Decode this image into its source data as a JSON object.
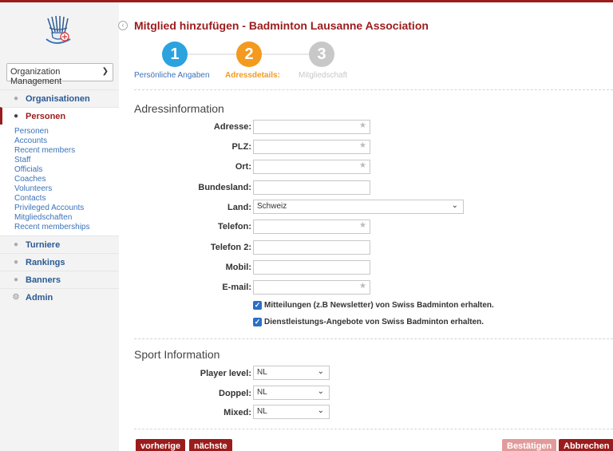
{
  "sidebar": {
    "org_select": "Organization Management",
    "items": [
      {
        "label": "Organisationen",
        "icon": "people-icon"
      },
      {
        "label": "Personen",
        "icon": "person-icon"
      },
      {
        "label": "Turniere",
        "icon": "shield-icon"
      },
      {
        "label": "Rankings",
        "icon": "ranking-icon"
      },
      {
        "label": "Banners",
        "icon": "banner-icon"
      },
      {
        "label": "Admin",
        "icon": "gear-icon"
      }
    ],
    "subitems": [
      "Personen",
      "Accounts",
      "Recent members",
      "Staff",
      "Officials",
      "Coaches",
      "Volunteers",
      "Contacts",
      "Privileged Accounts",
      "Mitgliedschaften",
      "Recent memberships"
    ]
  },
  "title": "Mitglied hinzufügen - Badminton Lausanne Association",
  "steps": [
    {
      "number": "1",
      "label": "Persönliche Angaben",
      "color": "#2aa3df"
    },
    {
      "number": "2",
      "label": "Adressdetails:",
      "color": "#f39a1f"
    },
    {
      "number": "3",
      "label": "Mitgliedschaft",
      "color": "#c8c8c8"
    }
  ],
  "address": {
    "section_title": "Adressinformation",
    "fields": {
      "adresse": {
        "label": "Adresse:",
        "value": ""
      },
      "plz": {
        "label": "PLZ:",
        "value": ""
      },
      "ort": {
        "label": "Ort:",
        "value": ""
      },
      "bundesland": {
        "label": "Bundesland:",
        "value": ""
      },
      "land": {
        "label": "Land:",
        "value": "Schweiz"
      },
      "telefon": {
        "label": "Telefon:",
        "value": ""
      },
      "telefon2": {
        "label": "Telefon 2:",
        "value": ""
      },
      "mobil": {
        "label": "Mobil:",
        "value": ""
      },
      "email": {
        "label": "E-mail:",
        "value": ""
      }
    },
    "checkbox1": "Mitteilungen (z.B Newsletter) von Swiss Badminton erhalten.",
    "checkbox2": "Dienstleistungs-Angebote von Swiss Badminton erhalten."
  },
  "sport": {
    "section_title": "Sport Information",
    "player_level": {
      "label": "Player level:",
      "value": "NL"
    },
    "doppel": {
      "label": "Doppel:",
      "value": "NL"
    },
    "mixed": {
      "label": "Mixed:",
      "value": "NL"
    }
  },
  "buttons": {
    "prev": "vorherige",
    "next": "nächste",
    "confirm": "Bestätigen",
    "cancel": "Abbrechen"
  },
  "colors": {
    "brand": "#9b1c1c",
    "link": "#3b73b9"
  }
}
